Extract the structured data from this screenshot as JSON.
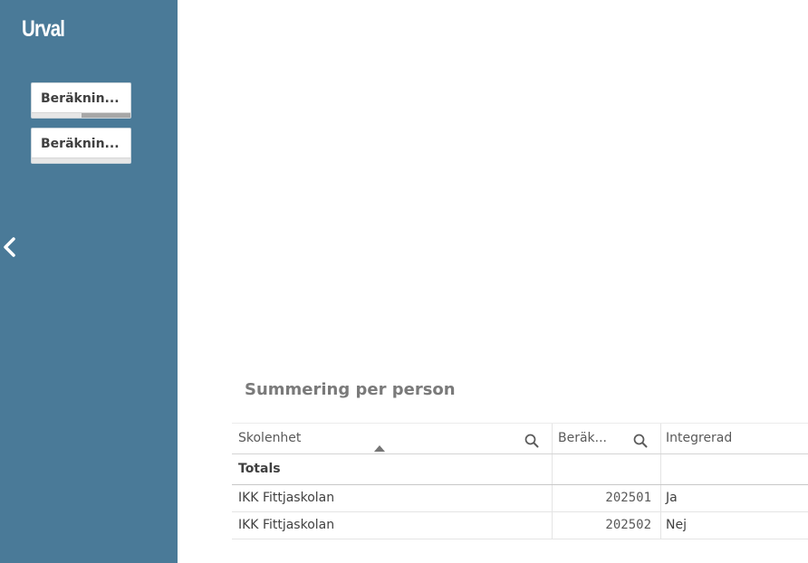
{
  "sidebar": {
    "title": "Urval",
    "filters": [
      {
        "label": "Beräknin...",
        "selected_fraction": 0.5
      },
      {
        "label": "Beräknin...",
        "selected_fraction": 0
      }
    ],
    "collapse_icon": "chevron-left-icon"
  },
  "table": {
    "title": "Summering per person",
    "columns": [
      "Skolenhet",
      "Beräk...",
      "Integrerad"
    ],
    "totals_label": "Totals",
    "rows": [
      [
        "IKK Fittjaskolan",
        "202501",
        "Ja"
      ],
      [
        "IKK Fittjaskolan",
        "202502",
        "Nej"
      ]
    ]
  },
  "colors": {
    "sidebar_bg": "#4a7a98",
    "title_gray": "#7a7a7a"
  }
}
